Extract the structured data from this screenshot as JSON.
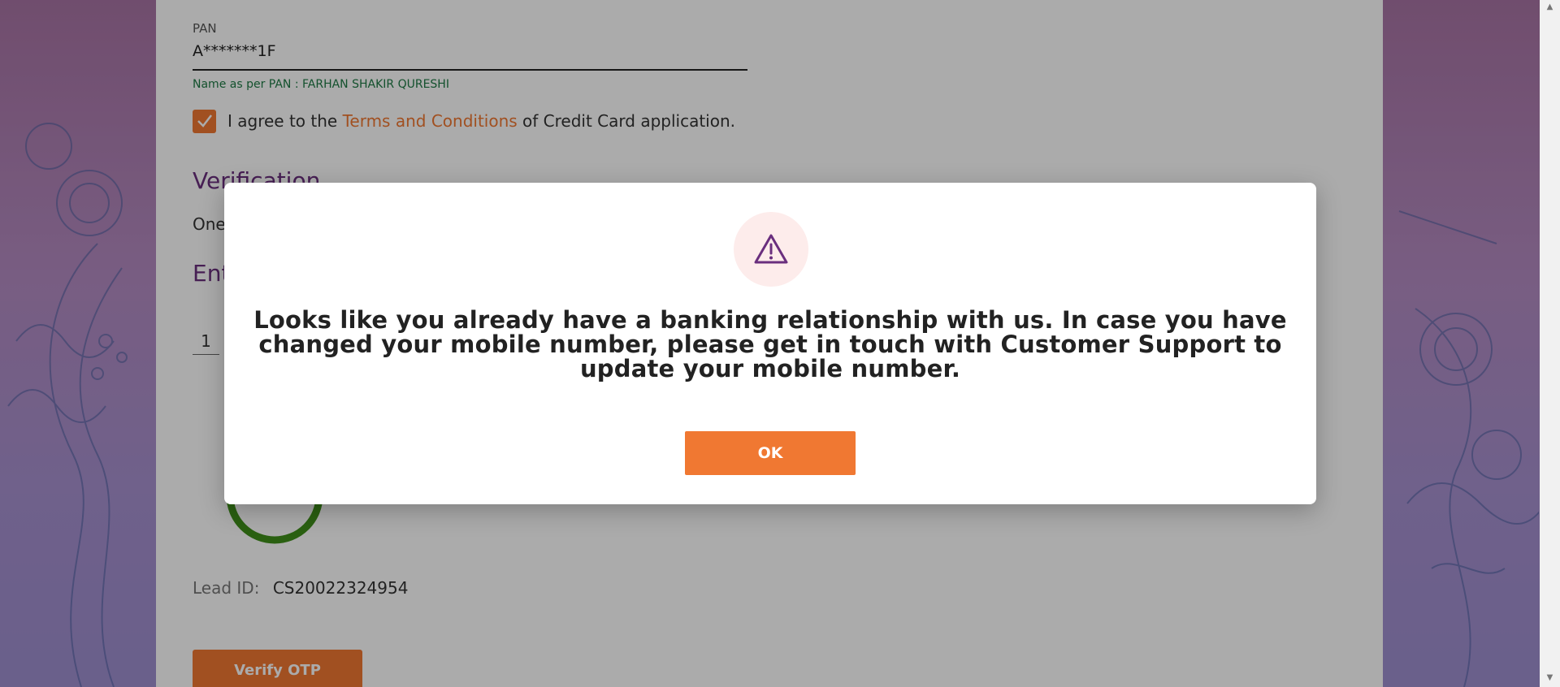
{
  "form": {
    "pan_label": "PAN",
    "pan_value": "A*******1F",
    "pan_name": "Name as per PAN : FARHAN SHAKIR QURESHI",
    "agree_prefix": "I agree to the ",
    "agree_link": "Terms and Conditions",
    "agree_suffix": " of Credit Card application.",
    "verification_title": "Verification",
    "one_text": "One",
    "ent_text": "Ent",
    "otp_first_digit": "1",
    "lead_label": "Lead ID:",
    "lead_value": "CS20022324954",
    "verify_button": "Verify OTP"
  },
  "modal": {
    "icon": "warning-triangle-icon",
    "message": "Looks like you already have a banking relationship with us. In case you have changed your mobile number, please get in touch with Customer Support to update your mobile number.",
    "ok_button": "OK"
  },
  "colors": {
    "accent": "#f07832",
    "heading_purple": "#6a2f7e",
    "success_green": "#1d7a44",
    "icon_bg": "#fdeceb"
  }
}
